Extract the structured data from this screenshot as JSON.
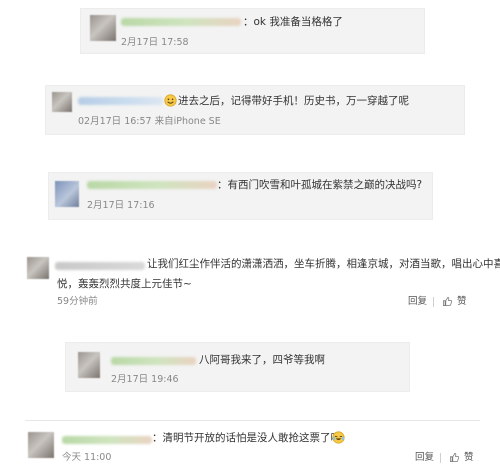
{
  "comments": [
    {
      "text": "：ok 我准备当格格了",
      "time": "2月17日 17:58"
    },
    {
      "text": "进去之后，记得带好手机！历史书，万一穿越了呢",
      "time": "02月17日 16:57 来自iPhone SE",
      "emoji": "smiley-icon"
    },
    {
      "text": "：有西门吹雪和叶孤城在紫禁之巅的决战吗?",
      "time": "2月17日 17:16"
    },
    {
      "text_line1": "让我们红尘作伴活的潇潇洒洒，坐车折腾，相逢京城，对酒当歌，唱出心中喜",
      "text_line2": "悦，轰轰烈烈共度上元佳节~",
      "time": "59分钟前",
      "reply_label": "回复",
      "like_label": "赞"
    },
    {
      "text": "八阿哥我来了，四爷等我啊",
      "time": "2月17日 19:46"
    },
    {
      "text": "：清明节开放的话怕是没人敢抢这票了吧",
      "time": "今天 11:00",
      "reply_label": "回复",
      "like_label": "赞",
      "emoji": "laughing-crying-icon"
    }
  ],
  "colors": {
    "card_bg": "#f3f3f3",
    "text": "#333333",
    "meta": "#888888"
  }
}
